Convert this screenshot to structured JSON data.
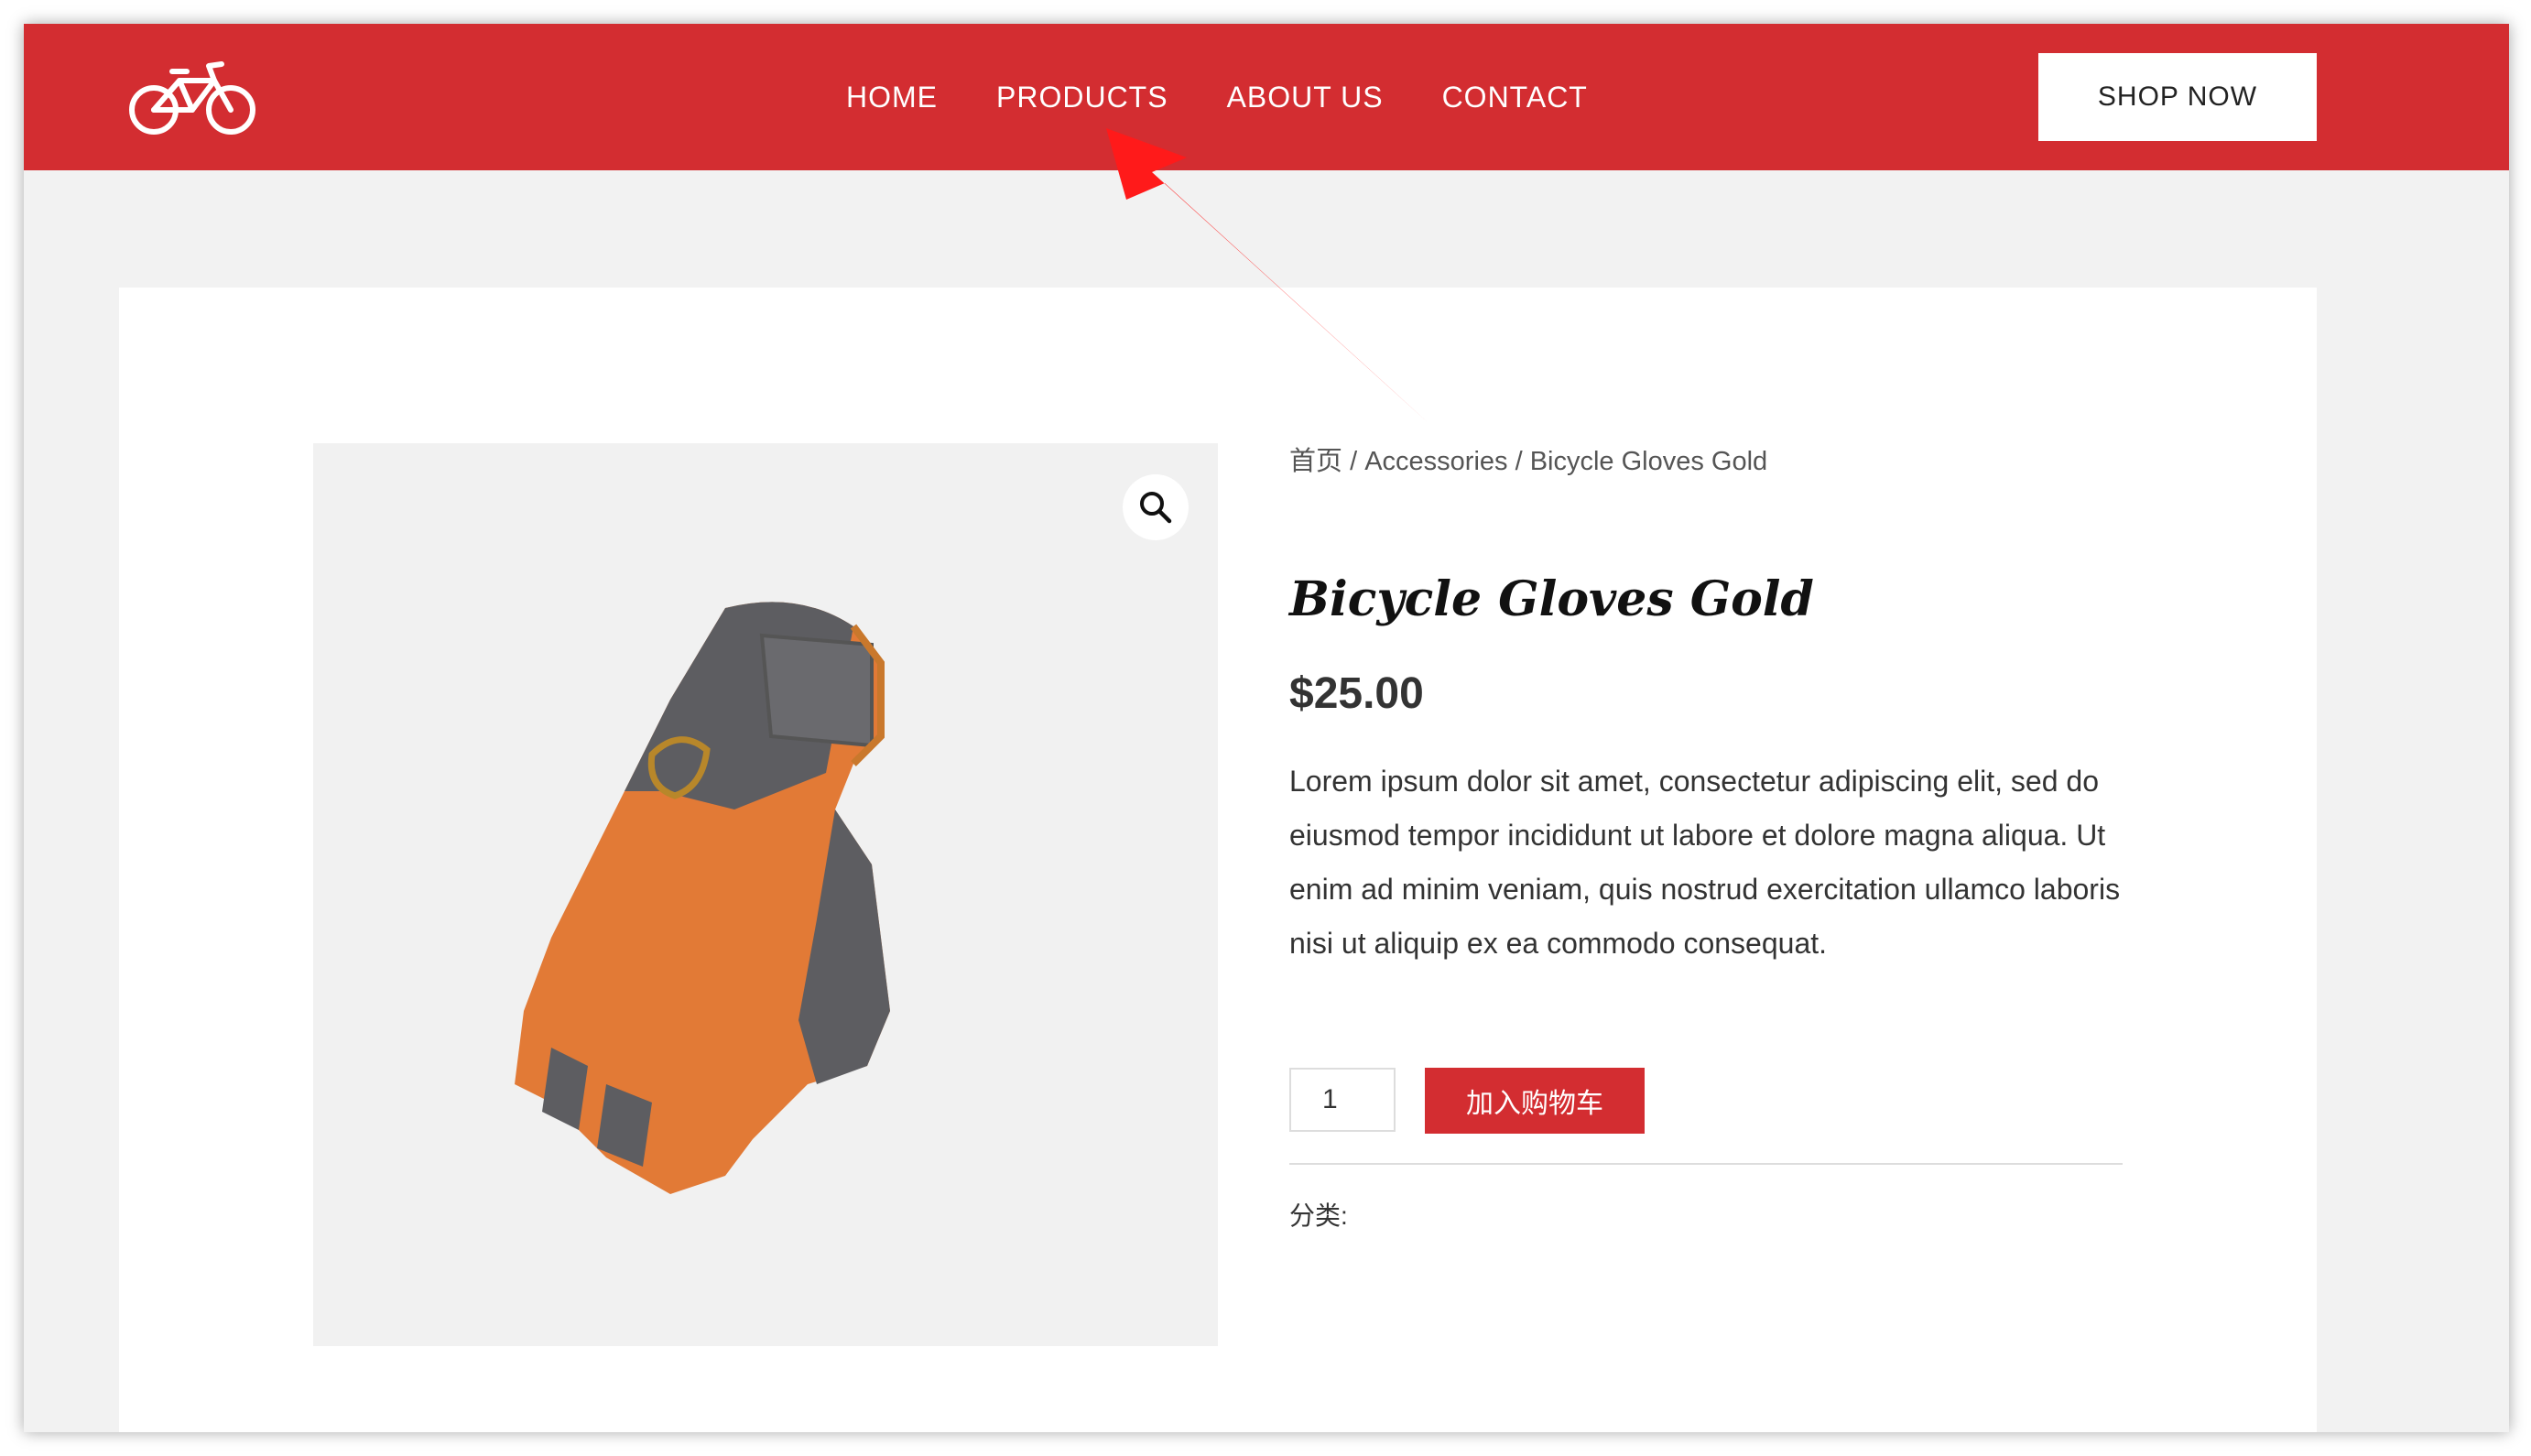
{
  "header": {
    "nav": [
      "HOME",
      "PRODUCTS",
      "ABOUT US",
      "CONTACT"
    ],
    "shop_now": "SHOP NOW"
  },
  "colors": {
    "brand_red": "#d32d31",
    "page_bg": "#f2f2f2",
    "annotation_arrow": "#ff1a1a"
  },
  "breadcrumb": {
    "home": "首页",
    "separator": " / ",
    "category": "Accessories",
    "current": "Bicycle Gloves Gold"
  },
  "product": {
    "title": "Bicycle Gloves Gold",
    "price": "$25.00",
    "description": "Lorem ipsum dolor sit amet, consectetur adipiscing elit, sed do eiusmod tempor incididunt ut labore et dolore magna aliqua. Ut enim ad minim veniam, quis nostrud exercitation ullamco laboris nisi ut aliquip ex ea commodo consequat.",
    "quantity": "1",
    "add_to_cart": "加入购物车",
    "category_label": "分类:"
  },
  "icons": {
    "logo": "bicycle-icon",
    "zoom": "magnifier-icon"
  }
}
